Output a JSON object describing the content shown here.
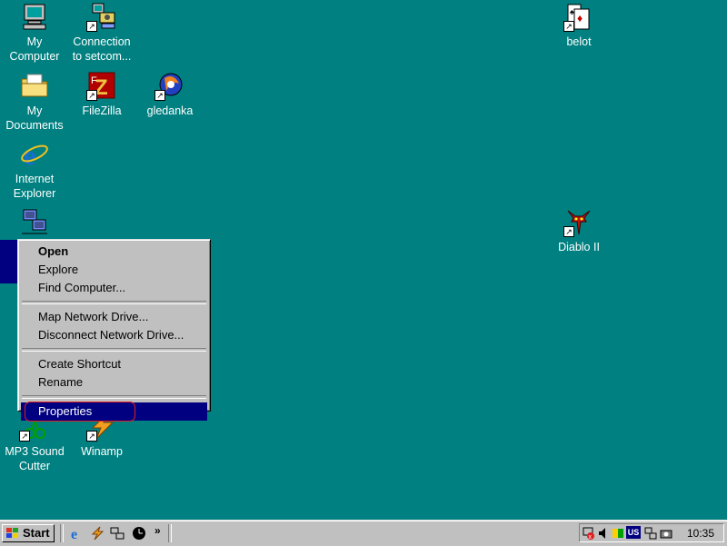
{
  "desktop": {
    "icons": [
      {
        "label": "My\nComputer"
      },
      {
        "label": "Connection\nto setcom..."
      },
      {
        "label": "belot"
      },
      {
        "label": "My\nDocuments"
      },
      {
        "label": "FileZilla"
      },
      {
        "label": "gledanka"
      },
      {
        "label": "Internet\nExplorer"
      },
      {
        "label": "Diablo II"
      },
      {
        "label": "MP3 Sound\nCutter"
      },
      {
        "label": "Winamp"
      }
    ]
  },
  "context_menu": {
    "items": [
      {
        "label": "Open",
        "bold": true
      },
      {
        "label": "Explore"
      },
      {
        "label": "Find Computer..."
      },
      {
        "label": "Map Network Drive..."
      },
      {
        "label": "Disconnect Network Drive..."
      },
      {
        "label": "Create Shortcut"
      },
      {
        "label": "Rename"
      },
      {
        "label": "Properties",
        "highlighted": true
      }
    ]
  },
  "taskbar": {
    "start_label": "Start",
    "clock": "10:35",
    "tray_lang": "US",
    "chevron": "»"
  },
  "colors": {
    "desktop": "#008080",
    "selection": "#000080",
    "annotation_ring": "#e02020"
  }
}
